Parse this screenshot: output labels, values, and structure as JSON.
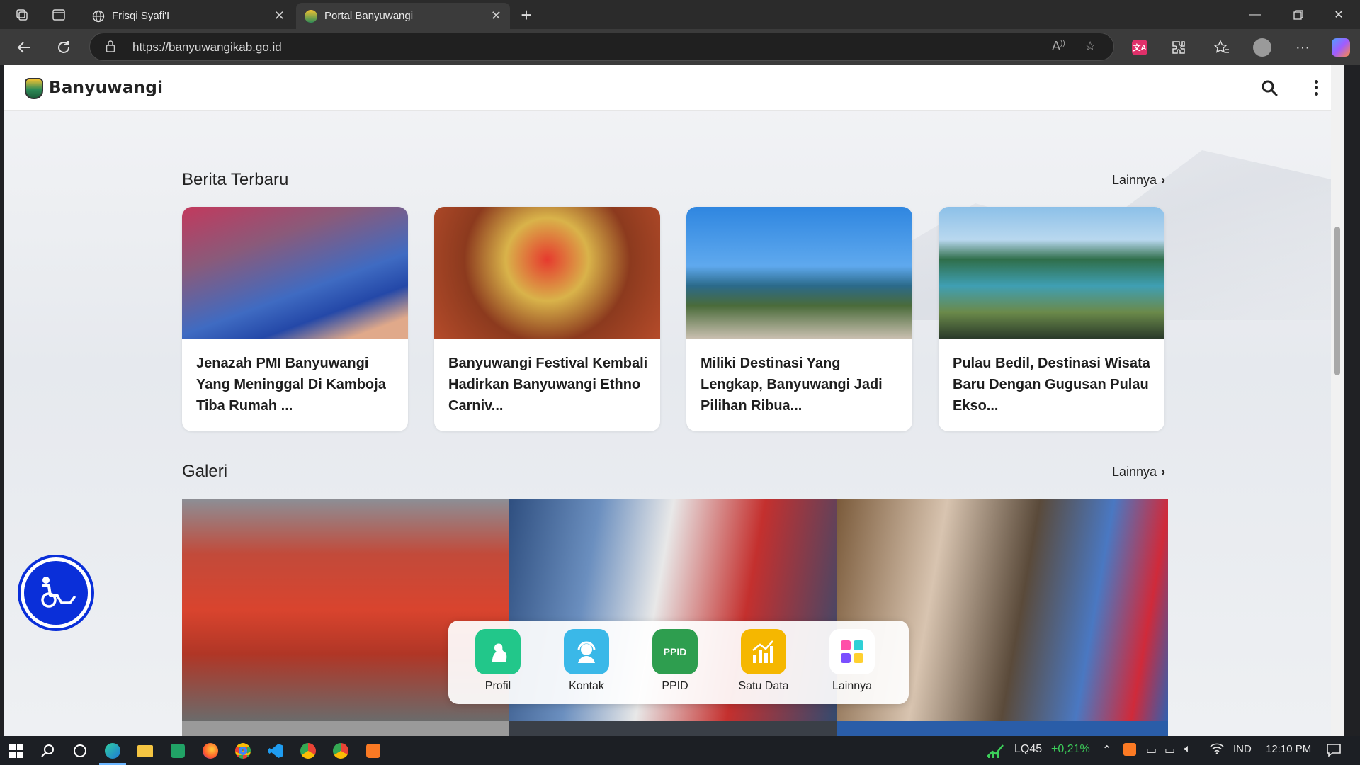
{
  "browser": {
    "tabs": [
      {
        "title": "Frisqi Syafi'I"
      },
      {
        "title": "Portal Banyuwangi"
      }
    ],
    "url": "https://banyuwangikab.go.id"
  },
  "site": {
    "brand": "Banyuwangi"
  },
  "news": {
    "title": "Berita Terbaru",
    "more": "Lainnya",
    "items": [
      {
        "title": "Jenazah PMI Banyuwangi Yang Meninggal Di Kamboja Tiba Rumah ..."
      },
      {
        "title": "Banyuwangi Festival Kembali Hadirkan Banyuwangi Ethno Carniv..."
      },
      {
        "title": "Miliki Destinasi Yang Lengkap, Banyuwangi Jadi Pilihan Ribua..."
      },
      {
        "title": "Pulau Bedil, Destinasi Wisata Baru Dengan Gugusan Pulau Ekso..."
      }
    ]
  },
  "gallery": {
    "title": "Galeri",
    "more": "Lainnya"
  },
  "quick": {
    "items": [
      {
        "label": "Profil",
        "color": "#22c78a"
      },
      {
        "label": "Kontak",
        "color": "#3ab8e8"
      },
      {
        "label": "PPID",
        "color": "#2e9e4f",
        "icon_text": "PPID"
      },
      {
        "label": "Satu Data",
        "color": "#f5b700"
      },
      {
        "label": "Lainnya",
        "color": "#ffffff"
      }
    ]
  },
  "taskbar": {
    "stock_name": "LQ45",
    "stock_change": "+0,21%",
    "lang": "IND",
    "time": "12:10 PM"
  }
}
